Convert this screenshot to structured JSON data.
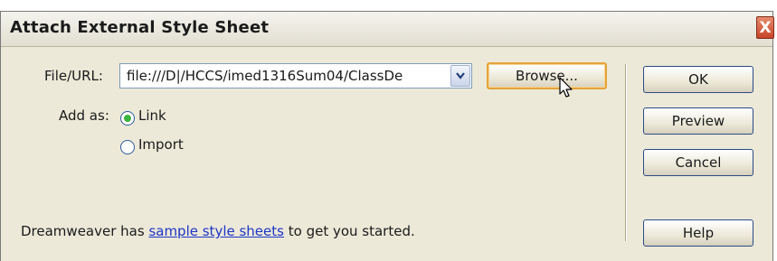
{
  "dialog": {
    "title": "Attach External Style Sheet",
    "close_glyph": "X"
  },
  "file_url": {
    "label": "File/URL:",
    "value": "file:///D|/HCCS/imed1316Sum04/ClassDe"
  },
  "add_as": {
    "label": "Add as:",
    "options": [
      {
        "label": "Link",
        "selected": true
      },
      {
        "label": "Import",
        "selected": false
      }
    ]
  },
  "buttons": {
    "browse": "Browse...",
    "ok": "OK",
    "preview": "Preview",
    "cancel": "Cancel",
    "help": "Help"
  },
  "footer": {
    "prefix": "Dreamweaver has ",
    "link": "sample style sheets",
    "suffix": " to get you started."
  },
  "colors": {
    "dialog_bg": "#ece9d8",
    "selected_radio": "#3cb33c",
    "link": "#1d35c8",
    "focus_border": "#e5a33a"
  }
}
